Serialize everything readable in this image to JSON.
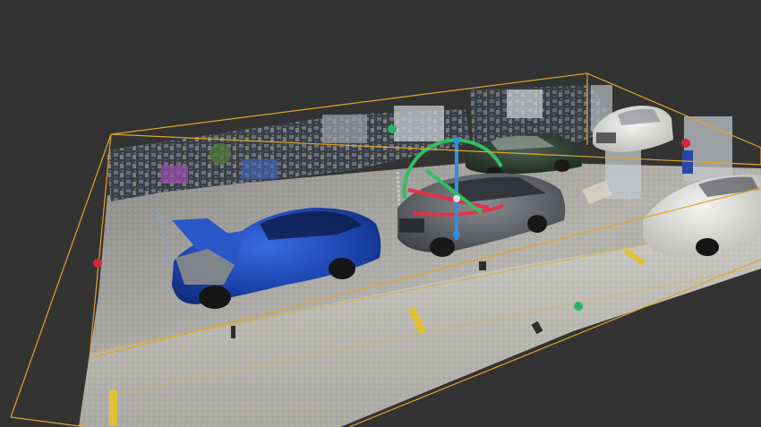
{
  "viewport": {
    "background": "#333333",
    "bounds_color": "#e0a52a",
    "handles": [
      {
        "name": "handle-red-left",
        "color": "#d0283c"
      },
      {
        "name": "handle-green-top",
        "color": "#29b463"
      },
      {
        "name": "handle-red-right",
        "color": "#d0283c"
      },
      {
        "name": "handle-green-bottom",
        "color": "#29b463"
      }
    ],
    "gizmo": {
      "x_axis_color": "#e0324a",
      "y_axis_color": "#2f8fe0",
      "z_axis_color": "#30c060"
    },
    "objects": [
      {
        "name": "blue-sedan-point-cloud",
        "color": "#1a3f9e"
      },
      {
        "name": "grey-sedan-point-cloud",
        "color": "#5c5f66"
      },
      {
        "name": "dark-green-sedan-point-cloud",
        "color": "#2e4034"
      },
      {
        "name": "white-sedan-point-cloud",
        "color": "#d6d6d2"
      },
      {
        "name": "white-suv-point-cloud",
        "color": "#e2e2e2"
      }
    ]
  }
}
